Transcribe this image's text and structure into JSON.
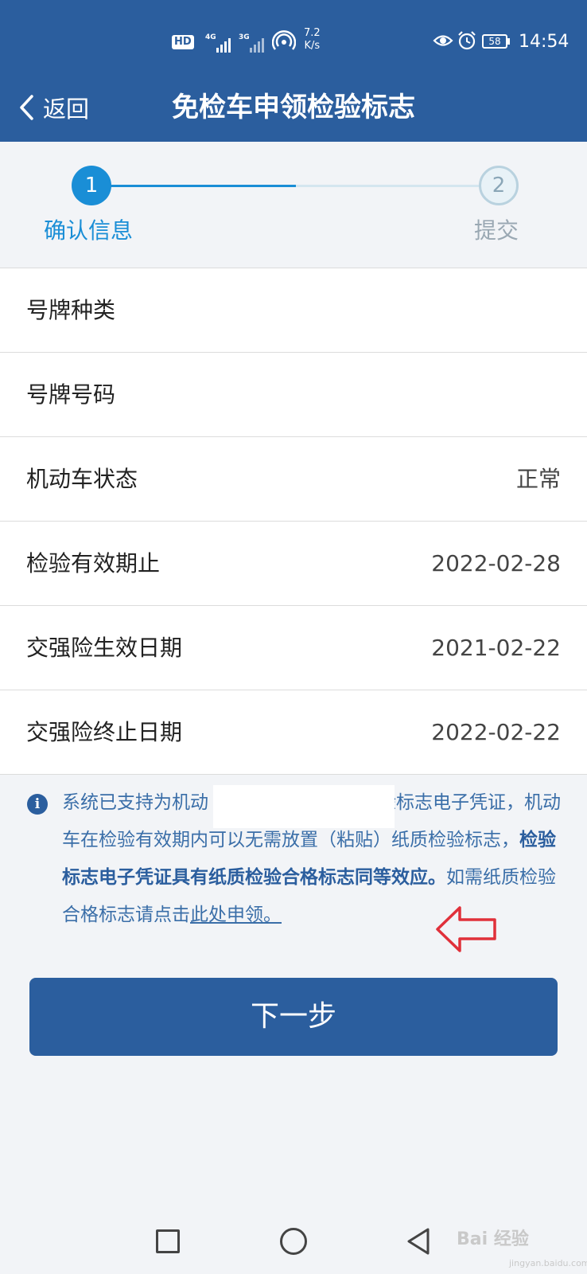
{
  "status_bar": {
    "hd": "HD",
    "signal1": "4G",
    "signal2": "3G",
    "speed_value": "7.2",
    "speed_unit": "K/s",
    "battery": "58",
    "time": "14:54"
  },
  "header": {
    "back_label": "返回",
    "title": "免检车申领检验标志"
  },
  "stepper": {
    "steps": [
      {
        "number": "1",
        "label": "确认信息",
        "active": true
      },
      {
        "number": "2",
        "label": "提交",
        "active": false
      }
    ]
  },
  "details": {
    "rows": [
      {
        "label": "号牌种类",
        "value": ""
      },
      {
        "label": "号牌号码",
        "value": ""
      },
      {
        "label": "机动车状态",
        "value": "正常"
      },
      {
        "label": "检验有效期止",
        "value": "2022-02-28"
      },
      {
        "label": "交强险生效日期",
        "value": "2021-02-22"
      },
      {
        "label": "交强险终止日期",
        "value": "2022-02-22"
      }
    ]
  },
  "notice": {
    "icon": "info-icon",
    "text_part1": "系统已支持为机动",
    "text_part2": "检验标志电子凭证，机动车在检验有效期内可以无需放置（粘贴）纸质检验标志，",
    "text_bold": "检验标志电子凭证具有纸质检验合格标志同等效应。",
    "text_part3": "如需纸质检验合格标志请点击",
    "link_label": "此处申领。"
  },
  "next_button": {
    "label": "下一步"
  },
  "watermark": {
    "text": "Bai 经验",
    "sub": "jingyan.baidu.com"
  },
  "colors": {
    "header": "#2b5e9e",
    "accent": "#1a8ed6",
    "annotation_arrow": "#e0303a"
  }
}
